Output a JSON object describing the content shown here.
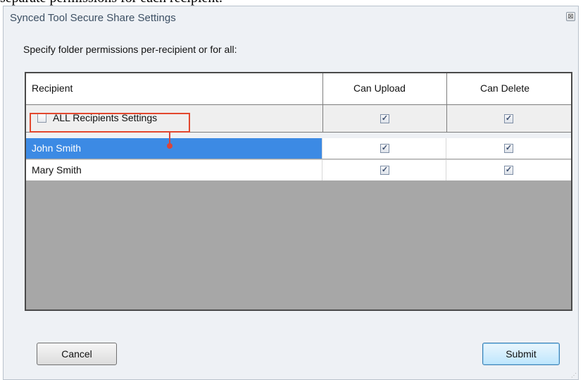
{
  "top_cut_text": "separate permissions for each recipient.",
  "window": {
    "title": "Synced Tool Secure Share Settings",
    "close_glyph": "⊠"
  },
  "instruction": "Specify folder permissions per-recipient or for all:",
  "table": {
    "headers": {
      "recipient": "Recipient",
      "can_upload": "Can Upload",
      "can_delete": "Can Delete"
    },
    "all_row": {
      "label": "ALL Recipients Settings",
      "checked": false,
      "can_upload": true,
      "can_delete": true
    },
    "rows": [
      {
        "name": "John Smith",
        "can_upload": true,
        "can_delete": true,
        "selected": true
      },
      {
        "name": "Mary Smith",
        "can_upload": true,
        "can_delete": true,
        "selected": false
      }
    ]
  },
  "buttons": {
    "cancel": "Cancel",
    "submit": "Submit"
  },
  "colors": {
    "selection": "#3c8ae4",
    "annotation": "#e2472e",
    "empty_grid": "#a7a7a7"
  },
  "checkmark_glyph": "✓"
}
